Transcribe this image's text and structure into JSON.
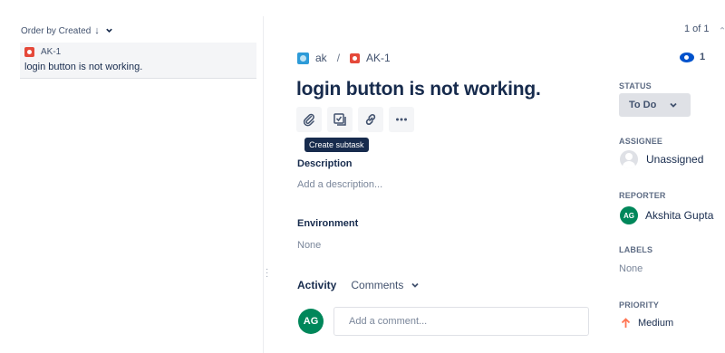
{
  "left_panel": {
    "order_label": "Order by Created",
    "sort_arrow": "↓",
    "sort_chevron": "⌄",
    "issue": {
      "key": "AK-1",
      "summary": "login button is not working."
    }
  },
  "pager": {
    "text": "1 of 1",
    "arrow": "⌃"
  },
  "breadcrumb": {
    "project": "ak",
    "separator": "/",
    "issue_key": "AK-1"
  },
  "watchers": {
    "count": "1"
  },
  "issue": {
    "title": "login button is not working.",
    "toolbar_tooltip": "Create subtask",
    "description_label": "Description",
    "description_placeholder": "Add a description...",
    "environment_label": "Environment",
    "environment_value": "None"
  },
  "activity": {
    "label": "Activity",
    "filter": "Comments",
    "comment_avatar": "AG",
    "comment_placeholder": "Add a comment..."
  },
  "sidebar": {
    "status_label": "STATUS",
    "status_value": "To Do",
    "assignee_label": "ASSIGNEE",
    "assignee_value": "Unassigned",
    "reporter_label": "REPORTER",
    "reporter_initials": "AG",
    "reporter_value": "Akshita Gupta",
    "labels_label": "LABELS",
    "labels_value": "None",
    "priority_label": "PRIORITY",
    "priority_value": "Medium"
  },
  "colors": {
    "bug_icon": "#e5493a",
    "avatar_green": "#00875a",
    "eye_blue": "#0052cc",
    "priority_orange": "#ff7452"
  },
  "icons": [
    "bug-icon",
    "project-icon",
    "eye-icon",
    "attach-icon",
    "subtask-icon",
    "link-icon",
    "more-icon",
    "chevron-down-icon",
    "arrow-up-icon"
  ]
}
